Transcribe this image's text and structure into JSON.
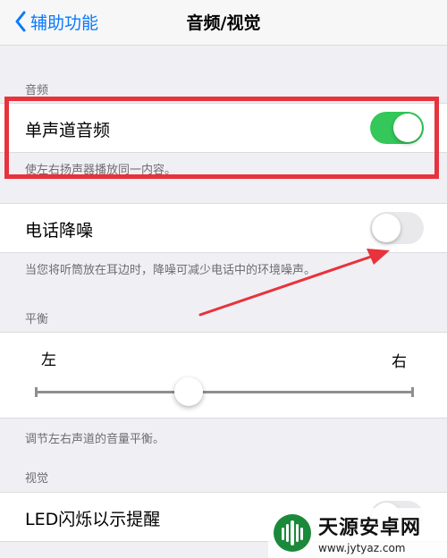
{
  "nav": {
    "back_label": "辅助功能",
    "title": "音频/视觉"
  },
  "audio": {
    "header": "音频",
    "mono_audio": {
      "label": "单声道音频",
      "enabled": true,
      "footer": "使左右扬声器播放同一内容。"
    },
    "noise_cancel": {
      "label": "电话降噪",
      "enabled": false,
      "footer": "当您将听筒放在耳边时，降噪可减少电话中的环境噪声。"
    }
  },
  "balance": {
    "header": "平衡",
    "left_label": "左",
    "right_label": "右",
    "value": 0.5,
    "footer": "调节左右声道的音量平衡。"
  },
  "visual": {
    "header": "视觉",
    "led_flash": {
      "label": "LED闪烁以示提醒",
      "enabled": false
    }
  },
  "annotation": {
    "highlight_color": "#e8323c"
  },
  "watermark": {
    "name": "天源安卓网",
    "url": "www.jytyaz.com"
  },
  "colors": {
    "accent": "#0a7aff",
    "switch_on": "#34c759",
    "switch_off": "#e9e9eb"
  }
}
